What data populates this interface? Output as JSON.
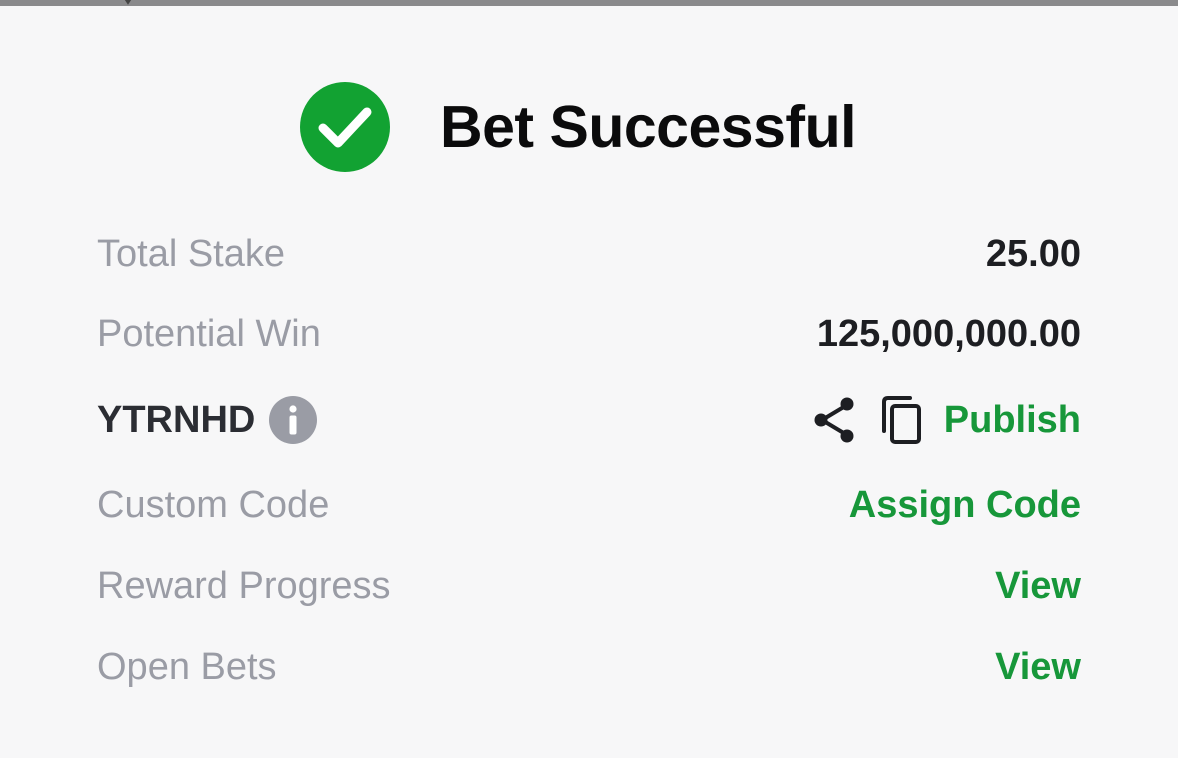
{
  "header": {
    "title": "Bet Successful",
    "status_icon": "check-circle-icon",
    "status_color": "#12a232"
  },
  "summary": {
    "total_stake": {
      "label": "Total Stake",
      "value": "25.00"
    },
    "potential_win": {
      "label": "Potential Win",
      "value": "125,000,000.00"
    },
    "booking": {
      "code": "YTRNHD",
      "info_icon": "info-icon",
      "share_icon": "share-icon",
      "copy_icon": "copy-icon",
      "publish_label": "Publish"
    },
    "custom_code": {
      "label": "Custom Code",
      "action": "Assign Code"
    },
    "reward_progress": {
      "label": "Reward Progress",
      "action": "View"
    },
    "open_bets": {
      "label": "Open Bets",
      "action": "View"
    }
  },
  "colors": {
    "accent_green": "#17973a",
    "label_gray": "#9a9ca5",
    "value_dark": "#1d1e22",
    "background": "#f7f7f8"
  }
}
